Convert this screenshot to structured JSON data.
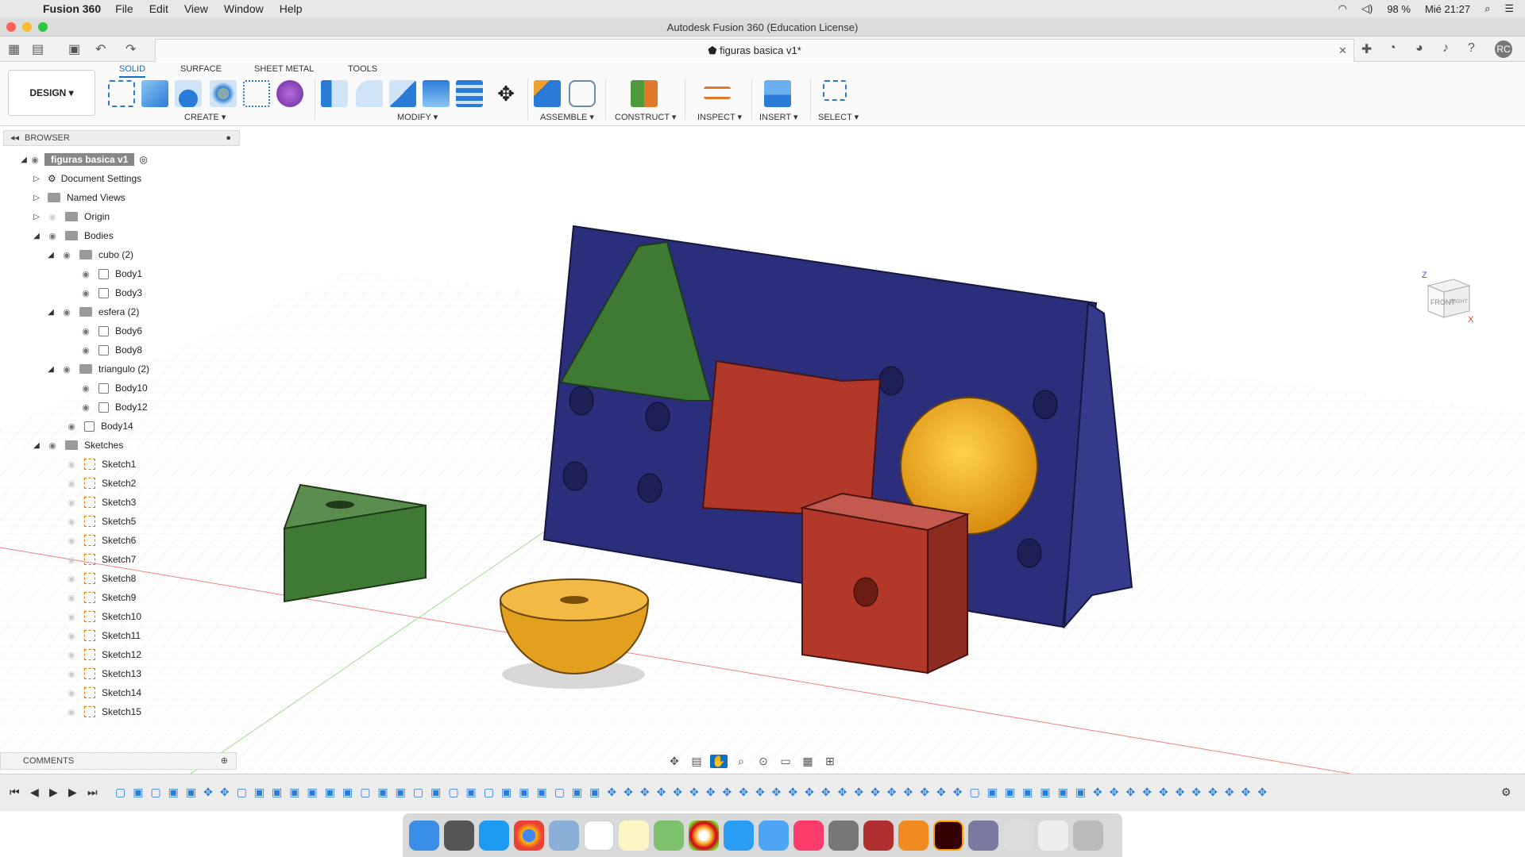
{
  "menubar": {
    "app": "Fusion 360",
    "items": [
      "File",
      "Edit",
      "View",
      "Window",
      "Help"
    ],
    "battery": "98 %",
    "clock": "Mié 21:27"
  },
  "window": {
    "title": "Autodesk Fusion 360 (Education License)"
  },
  "document": {
    "tab_title": "figuras basica v1*",
    "user_initials": "RC"
  },
  "toolbar": {
    "workspace": "DESIGN",
    "tabs": [
      "SOLID",
      "SURFACE",
      "SHEET METAL",
      "TOOLS"
    ],
    "groups": [
      "CREATE",
      "MODIFY",
      "ASSEMBLE",
      "CONSTRUCT",
      "INSPECT",
      "INSERT",
      "SELECT"
    ]
  },
  "browser": {
    "header": "BROWSER",
    "root": "figuras basica v1",
    "document_settings": "Document Settings",
    "named_views": "Named Views",
    "origin": "Origin",
    "bodies": "Bodies",
    "groups": [
      {
        "name": "cubo (2)",
        "bodies": [
          "Body1",
          "Body3"
        ]
      },
      {
        "name": "esfera (2)",
        "bodies": [
          "Body6",
          "Body8"
        ]
      },
      {
        "name": "triangulo (2)",
        "bodies": [
          "Body10",
          "Body12"
        ]
      }
    ],
    "loose_body": "Body14",
    "sketches_label": "Sketches",
    "sketches": [
      "Sketch1",
      "Sketch2",
      "Sketch3",
      "Sketch5",
      "Sketch6",
      "Sketch7",
      "Sketch8",
      "Sketch9",
      "Sketch10",
      "Sketch11",
      "Sketch12",
      "Sketch13",
      "Sketch14",
      "Sketch15"
    ]
  },
  "comments": {
    "label": "COMMENTS"
  },
  "viewcube": {
    "front": "FRONT",
    "right": "RIGHT",
    "z": "Z",
    "x": "X"
  },
  "colors": {
    "accent": "#0a72c4",
    "blue_body": "#2b2e7a",
    "green_body": "#3f7a35",
    "red_body": "#b2382a",
    "yellow_body": "#e3a01f"
  }
}
